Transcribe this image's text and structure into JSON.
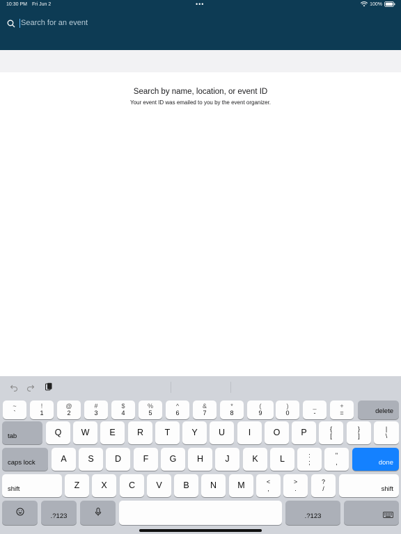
{
  "status_bar": {
    "time": "10:30 PM",
    "date": "Fri Jun 2",
    "dots": "•••",
    "battery": "100%"
  },
  "search": {
    "placeholder": "Search for an event"
  },
  "hint": {
    "title": "Search by name, location, or event ID",
    "subtitle": "Your event ID was emailed to you by the event organizer."
  },
  "keyboard": {
    "row1": [
      {
        "top": "~",
        "bottom": "`"
      },
      {
        "top": "!",
        "bottom": "1"
      },
      {
        "top": "@",
        "bottom": "2"
      },
      {
        "top": "#",
        "bottom": "3"
      },
      {
        "top": "$",
        "bottom": "4"
      },
      {
        "top": "%",
        "bottom": "5"
      },
      {
        "top": "^",
        "bottom": "6"
      },
      {
        "top": "&",
        "bottom": "7"
      },
      {
        "top": "*",
        "bottom": "8"
      },
      {
        "top": "(",
        "bottom": "9"
      },
      {
        "top": ")",
        "bottom": "0"
      },
      {
        "top": "_",
        "bottom": "-"
      },
      {
        "top": "+",
        "bottom": "="
      }
    ],
    "delete": "delete",
    "tab": "tab",
    "row2": [
      "Q",
      "W",
      "E",
      "R",
      "T",
      "Y",
      "U",
      "I",
      "O",
      "P"
    ],
    "row2_sym": [
      {
        "top": "{",
        "bottom": "["
      },
      {
        "top": "}",
        "bottom": "]"
      },
      {
        "top": "|",
        "bottom": "\\"
      }
    ],
    "caps": "caps lock",
    "row3": [
      "A",
      "S",
      "D",
      "F",
      "G",
      "H",
      "J",
      "K",
      "L"
    ],
    "row3_sym": [
      {
        "top": ":",
        "bottom": ";"
      },
      {
        "top": "\"",
        "bottom": ","
      }
    ],
    "done": "done",
    "shift": "shift",
    "row4": [
      "Z",
      "X",
      "C",
      "V",
      "B",
      "N",
      "M"
    ],
    "row4_sym": [
      {
        "top": "<",
        "bottom": ","
      },
      {
        "top": ">",
        "bottom": "."
      },
      {
        "top": "?",
        "bottom": "/"
      }
    ],
    "numbers": ".?123"
  },
  "colors": {
    "header": "#0d3b54",
    "done": "#1481ff"
  }
}
